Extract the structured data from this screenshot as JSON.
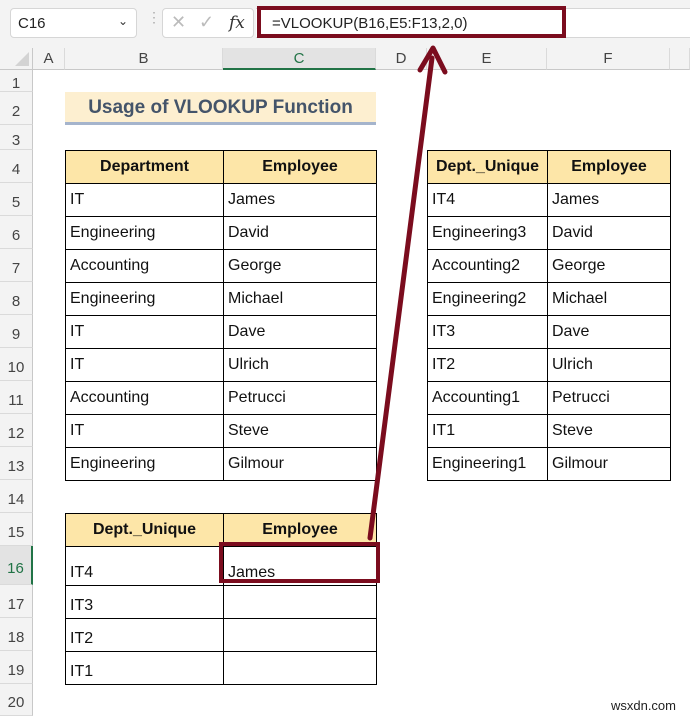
{
  "formula_bar": {
    "name_box": "C16",
    "cancel_icon": "✕",
    "enter_icon": "✓",
    "fx_label": "fx",
    "formula": "=VLOOKUP(B16,E5:F13,2,0)"
  },
  "columns": [
    "A",
    "B",
    "C",
    "D",
    "E",
    "F"
  ],
  "rows": [
    "1",
    "2",
    "3",
    "4",
    "5",
    "6",
    "7",
    "8",
    "9",
    "10",
    "11",
    "12",
    "13",
    "14",
    "15",
    "16",
    "17",
    "18",
    "19",
    "20"
  ],
  "selected_column": "C",
  "selected_row": "16",
  "title": "Usage of VLOOKUP Function",
  "table1": {
    "headers": [
      "Department",
      "Employee"
    ],
    "rows": [
      [
        "IT",
        "James"
      ],
      [
        "Engineering",
        "David"
      ],
      [
        "Accounting",
        "George"
      ],
      [
        "Engineering",
        "Michael"
      ],
      [
        "IT",
        "Dave"
      ],
      [
        "IT",
        "Ulrich"
      ],
      [
        "Accounting",
        "Petrucci"
      ],
      [
        "IT",
        "Steve"
      ],
      [
        "Engineering",
        "Gilmour"
      ]
    ]
  },
  "table2": {
    "headers": [
      "Dept._Unique",
      "Employee"
    ],
    "rows": [
      [
        "IT4",
        "James"
      ],
      [
        "Engineering3",
        "David"
      ],
      [
        "Accounting2",
        "George"
      ],
      [
        "Engineering2",
        "Michael"
      ],
      [
        "IT3",
        "Dave"
      ],
      [
        "IT2",
        "Ulrich"
      ],
      [
        "Accounting1",
        "Petrucci"
      ],
      [
        "IT1",
        "Steve"
      ],
      [
        "Engineering1",
        "Gilmour"
      ]
    ]
  },
  "table3": {
    "headers": [
      "Dept._Unique",
      "Employee"
    ],
    "rows": [
      [
        "IT4",
        "James"
      ],
      [
        "IT3",
        ""
      ],
      [
        "IT2",
        ""
      ],
      [
        "IT1",
        ""
      ]
    ]
  },
  "annotation_color": "#7b0c1e",
  "watermark": "wsxdn.com"
}
